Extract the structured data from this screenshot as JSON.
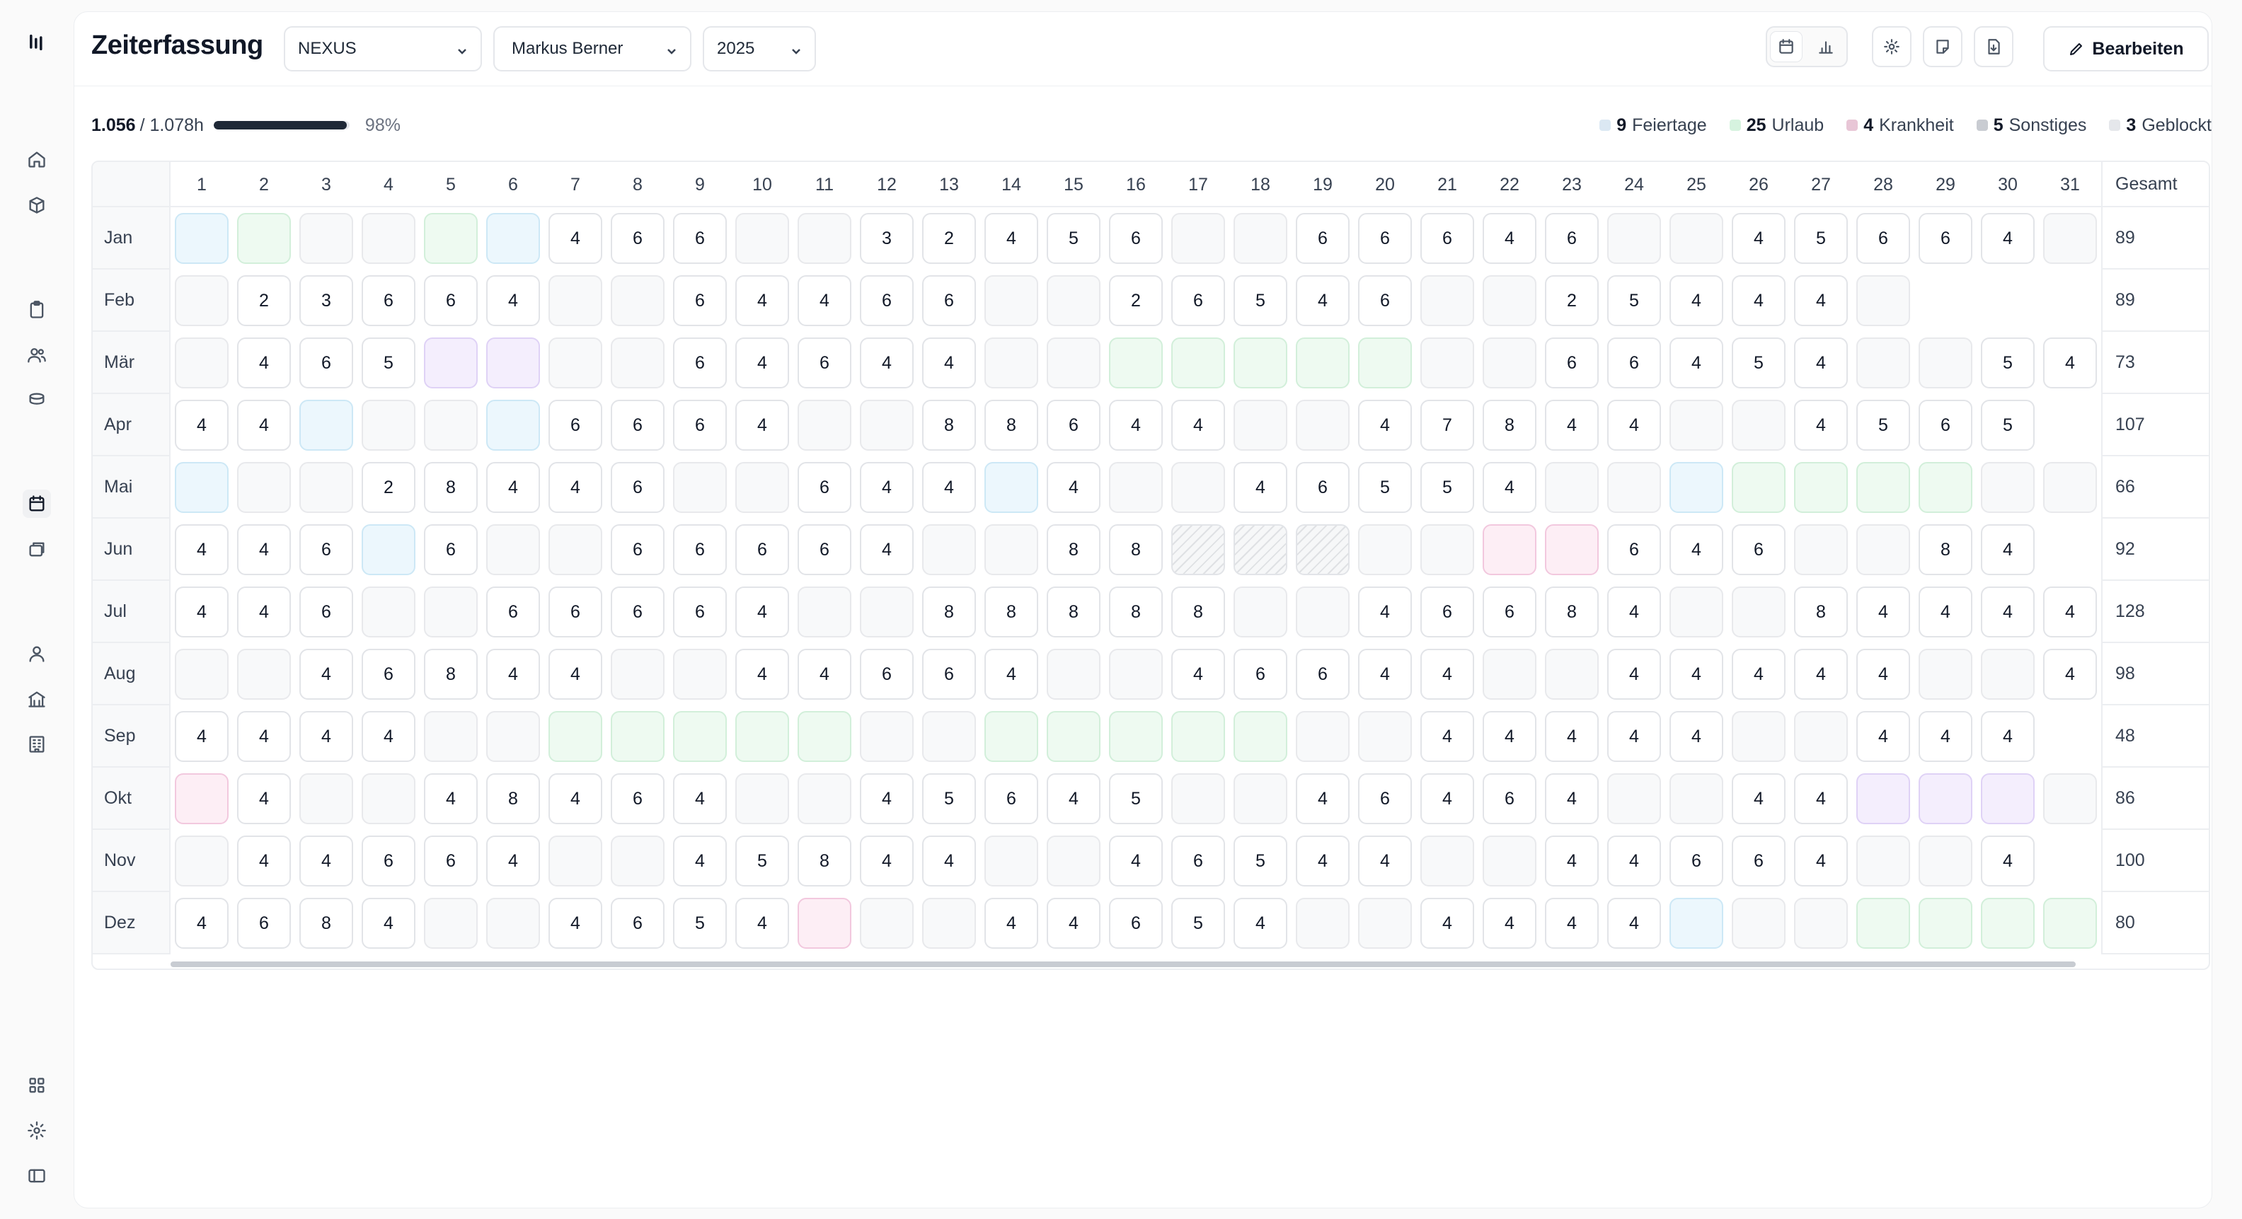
{
  "header": {
    "title": "Zeiterfassung",
    "project": "NEXUS",
    "person": "Markus Berner",
    "year": "2025",
    "edit_label": "Bearbeiten"
  },
  "progress": {
    "used": "1.056",
    "total": "/ 1.078h",
    "percent_label": "98%",
    "fraction": 0.98
  },
  "legend": [
    {
      "count": "9",
      "label": "Feiertage",
      "color": "#dbe8f3"
    },
    {
      "count": "25",
      "label": "Urlaub",
      "color": "#d6f3df"
    },
    {
      "count": "4",
      "label": "Krankheit",
      "color": "#e8c6d6"
    },
    {
      "count": "5",
      "label": "Sonstiges",
      "color": "#c9ccd2"
    },
    {
      "count": "3",
      "label": "Geblockt",
      "color": "#e5e7eb"
    }
  ],
  "grid": {
    "total_header": "Gesamt",
    "days": [
      "1",
      "2",
      "3",
      "4",
      "5",
      "6",
      "7",
      "8",
      "9",
      "10",
      "11",
      "12",
      "13",
      "14",
      "15",
      "16",
      "17",
      "18",
      "19",
      "20",
      "21",
      "22",
      "23",
      "24",
      "25",
      "26",
      "27",
      "28",
      "29",
      "30",
      "31"
    ],
    "months": [
      {
        "name": "Jan",
        "total": "89",
        "cells": [
          "H",
          "U",
          "",
          "",
          "U",
          "H",
          "4",
          "6",
          "6",
          "",
          "",
          "3",
          "2",
          "4",
          "5",
          "6",
          "",
          "",
          "6",
          "6",
          "6",
          "4",
          "6",
          "",
          "",
          "4",
          "5",
          "6",
          "6",
          "4",
          ""
        ]
      },
      {
        "name": "Feb",
        "total": "89",
        "cells": [
          "",
          "2",
          "3",
          "6",
          "6",
          "4",
          "",
          "",
          "6",
          "4",
          "4",
          "6",
          "6",
          "",
          "",
          "2",
          "6",
          "5",
          "4",
          "6",
          "",
          "",
          "2",
          "5",
          "4",
          "4",
          "4",
          "",
          "-",
          "-",
          "-"
        ]
      },
      {
        "name": "Mär",
        "total": "73",
        "cells": [
          "",
          "4",
          "6",
          "5",
          "S",
          "S",
          "",
          "",
          "6",
          "4",
          "6",
          "4",
          "4",
          "",
          "",
          "U",
          "U",
          "U",
          "U",
          "U",
          "",
          "",
          "6",
          "6",
          "4",
          "5",
          "4",
          "",
          "",
          "5",
          "4"
        ]
      },
      {
        "name": "Apr",
        "total": "107",
        "cells": [
          "4",
          "4",
          "H",
          "",
          "",
          "H",
          "6",
          "6",
          "6",
          "4",
          "",
          "",
          "8",
          "8",
          "6",
          "4",
          "4",
          "",
          "",
          "4",
          "7",
          "8",
          "4",
          "4",
          "",
          "",
          "4",
          "5",
          "6",
          "5",
          "-"
        ]
      },
      {
        "name": "Mai",
        "total": "66",
        "cells": [
          "H",
          "",
          "",
          "2",
          "8",
          "4",
          "4",
          "6",
          "",
          "",
          "6",
          "4",
          "4",
          "H",
          "4",
          "",
          "",
          "4",
          "6",
          "5",
          "5",
          "4",
          "",
          "",
          "H",
          "U",
          "U",
          "U",
          "U",
          "",
          ""
        ]
      },
      {
        "name": "Jun",
        "total": "92",
        "cells": [
          "4",
          "4",
          "6",
          "H",
          "6",
          "",
          "",
          "6",
          "6",
          "6",
          "6",
          "4",
          "",
          "",
          "8",
          "8",
          "B",
          "B",
          "B",
          "",
          "",
          "K",
          "K",
          "6",
          "4",
          "6",
          "",
          "",
          "8",
          "4",
          "-"
        ]
      },
      {
        "name": "Jul",
        "total": "128",
        "cells": [
          "4",
          "4",
          "6",
          "",
          "",
          "6",
          "6",
          "6",
          "6",
          "4",
          "",
          "",
          "8",
          "8",
          "8",
          "8",
          "8",
          "",
          "",
          "4",
          "6",
          "6",
          "8",
          "4",
          "",
          "",
          "8",
          "4",
          "4",
          "4",
          "4"
        ]
      },
      {
        "name": "Aug",
        "total": "98",
        "cells": [
          "",
          "",
          "4",
          "6",
          "8",
          "4",
          "4",
          "",
          "",
          "4",
          "4",
          "6",
          "6",
          "4",
          "",
          "",
          "4",
          "6",
          "6",
          "4",
          "4",
          "",
          "",
          "4",
          "4",
          "4",
          "4",
          "4",
          "",
          "",
          "4"
        ]
      },
      {
        "name": "Sep",
        "total": "48",
        "cells": [
          "4",
          "4",
          "4",
          "4",
          "",
          "",
          "U",
          "U",
          "U",
          "U",
          "U",
          "",
          "",
          "U",
          "U",
          "U",
          "U",
          "U",
          "",
          "",
          "4",
          "4",
          "4",
          "4",
          "4",
          "",
          "",
          "4",
          "4",
          "4",
          "-"
        ]
      },
      {
        "name": "Okt",
        "total": "86",
        "cells": [
          "K",
          "4",
          "",
          "",
          "4",
          "8",
          "4",
          "6",
          "4",
          "",
          "",
          "4",
          "5",
          "6",
          "4",
          "5",
          "",
          "",
          "4",
          "6",
          "4",
          "6",
          "4",
          "",
          "",
          "4",
          "4",
          "S",
          "S",
          "S",
          ""
        ]
      },
      {
        "name": "Nov",
        "total": "100",
        "cells": [
          "",
          "4",
          "4",
          "6",
          "6",
          "4",
          "",
          "",
          "4",
          "5",
          "8",
          "4",
          "4",
          "",
          "",
          "4",
          "6",
          "5",
          "4",
          "4",
          "",
          "",
          "4",
          "4",
          "6",
          "6",
          "4",
          "",
          "",
          "4",
          "-"
        ]
      },
      {
        "name": "Dez",
        "total": "80",
        "cells": [
          "4",
          "6",
          "8",
          "4",
          "",
          "",
          "4",
          "6",
          "5",
          "4",
          "K",
          "",
          "",
          "4",
          "4",
          "6",
          "5",
          "4",
          "",
          "",
          "4",
          "4",
          "4",
          "4",
          "H",
          "",
          "",
          "U",
          "U",
          "U",
          "U"
        ]
      }
    ]
  }
}
